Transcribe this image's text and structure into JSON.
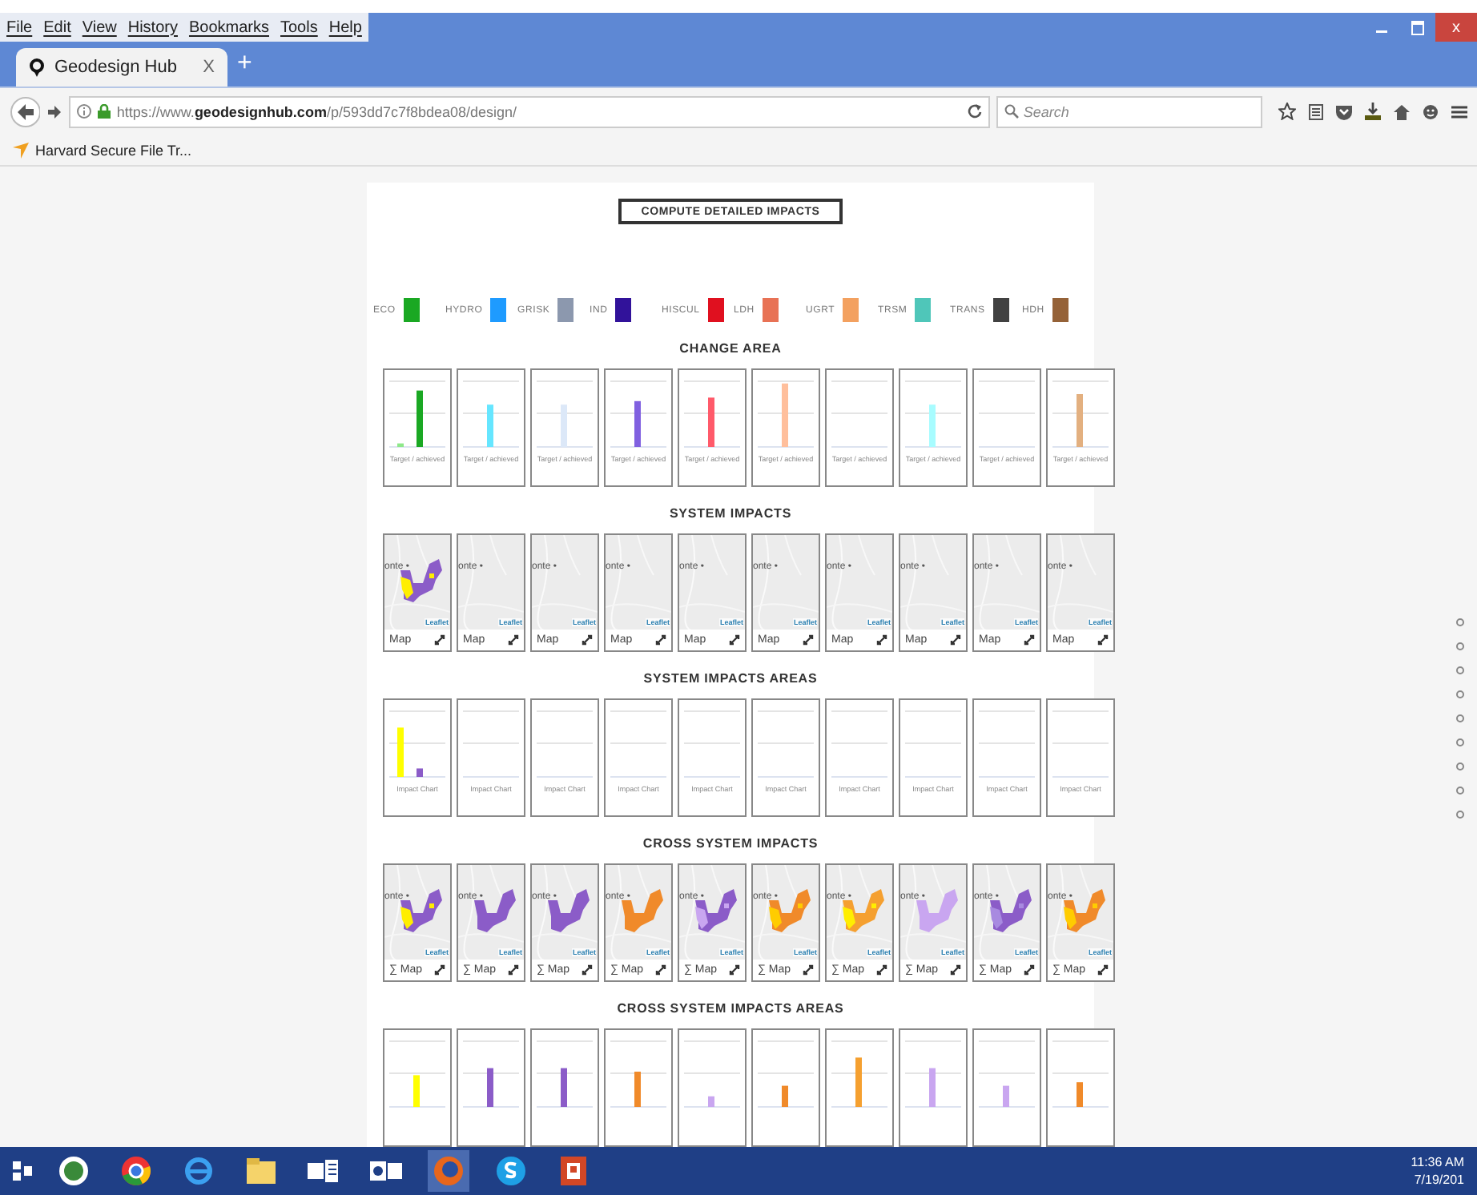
{
  "menu": [
    "File",
    "Edit",
    "View",
    "History",
    "Bookmarks",
    "Tools",
    "Help"
  ],
  "window_controls": {
    "close": "x"
  },
  "tab": {
    "title": "Geodesign Hub",
    "close": "X",
    "new_tab": "+",
    "selected": true
  },
  "address": {
    "prefix": "https://www.",
    "host": "geodesignhub.com",
    "path": "/p/593dd7c7f8bdea08/design/"
  },
  "search": {
    "placeholder": "Search"
  },
  "bookmarks": [
    "Harvard Secure File Tr..."
  ],
  "page": {
    "button": "COMPUTE DETAILED IMPACTS",
    "legend": [
      {
        "label": "ECO",
        "color": "#1aa823"
      },
      {
        "label": "HYDRO",
        "color": "#1e9bff"
      },
      {
        "label": "GRISK",
        "color": "#8c98ae"
      },
      {
        "label": "IND",
        "color": "#31129a"
      },
      {
        "label": "HISCUL",
        "color": "#e0101f"
      },
      {
        "label": "LDH",
        "color": "#e87255"
      },
      {
        "label": "UGRT",
        "color": "#f3a160"
      },
      {
        "label": "TRSM",
        "color": "#4fc6b9"
      },
      {
        "label": "TRANS",
        "color": "#414141"
      },
      {
        "label": "HDH",
        "color": "#956238"
      }
    ],
    "sections": [
      {
        "title": "CHANGE AREA",
        "cells": [
          {
            "kind": "bars",
            "caption": "Target / achieved"
          },
          {
            "kind": "bars",
            "caption": "Target / achieved"
          },
          {
            "kind": "bars",
            "caption": "Target / achieved"
          },
          {
            "kind": "bars",
            "caption": "Target / achieved"
          },
          {
            "kind": "bars",
            "caption": "Target / achieved"
          },
          {
            "kind": "bars",
            "caption": "Target / achieved"
          },
          {
            "kind": "bars",
            "caption": "Target / achieved"
          },
          {
            "kind": "bars",
            "caption": "Target / achieved"
          },
          {
            "kind": "bars",
            "caption": "Target / achieved"
          },
          {
            "kind": "bars",
            "caption": "Target / achieved"
          }
        ]
      },
      {
        "title": "SYSTEM IMPACTS",
        "cells": [
          {
            "kind": "map",
            "place": "onte •",
            "attribution": "Leaflet",
            "label": "Map"
          },
          {
            "kind": "map",
            "place": "onte •",
            "attribution": "Leaflet",
            "label": "Map"
          },
          {
            "kind": "map",
            "place": "onte •",
            "attribution": "Leaflet",
            "label": "Map"
          },
          {
            "kind": "map",
            "place": "onte •",
            "attribution": "Leaflet",
            "label": "Map"
          },
          {
            "kind": "map",
            "place": "onte •",
            "attribution": "Leaflet",
            "label": "Map"
          },
          {
            "kind": "map",
            "place": "onte •",
            "attribution": "Leaflet",
            "label": "Map"
          },
          {
            "kind": "map",
            "place": "onte •",
            "attribution": "Leaflet",
            "label": "Map"
          },
          {
            "kind": "map",
            "place": "onte •",
            "attribution": "Leaflet",
            "label": "Map"
          },
          {
            "kind": "map",
            "place": "onte •",
            "attribution": "Leaflet",
            "label": "Map"
          },
          {
            "kind": "map",
            "place": "onte •",
            "attribution": "Leaflet",
            "label": "Map"
          }
        ]
      },
      {
        "title": "SYSTEM IMPACTS AREAS",
        "cells": [
          {
            "kind": "bars",
            "caption": "Impact Chart"
          },
          {
            "kind": "bars",
            "caption": "Impact Chart"
          },
          {
            "kind": "bars",
            "caption": "Impact Chart"
          },
          {
            "kind": "bars",
            "caption": "Impact Chart"
          },
          {
            "kind": "bars",
            "caption": "Impact Chart"
          },
          {
            "kind": "bars",
            "caption": "Impact Chart"
          },
          {
            "kind": "bars",
            "caption": "Impact Chart"
          },
          {
            "kind": "bars",
            "caption": "Impact Chart"
          },
          {
            "kind": "bars",
            "caption": "Impact Chart"
          },
          {
            "kind": "bars",
            "caption": "Impact Chart"
          }
        ]
      },
      {
        "title": "CROSS SYSTEM IMPACTS",
        "cells": [
          {
            "kind": "map",
            "place": "onte •",
            "attribution": "Leaflet",
            "label": "∑ Map"
          },
          {
            "kind": "map",
            "place": "onte •",
            "attribution": "Leaflet",
            "label": "∑ Map"
          },
          {
            "kind": "map",
            "place": "onte •",
            "attribution": "Leaflet",
            "label": "∑ Map"
          },
          {
            "kind": "map",
            "place": "onte •",
            "attribution": "Leaflet",
            "label": "∑ Map"
          },
          {
            "kind": "map",
            "place": "onte •",
            "attribution": "Leaflet",
            "label": "∑ Map"
          },
          {
            "kind": "map",
            "place": "onte •",
            "attribution": "Leaflet",
            "label": "∑ Map"
          },
          {
            "kind": "map",
            "place": "onte •",
            "attribution": "Leaflet",
            "label": "∑ Map"
          },
          {
            "kind": "map",
            "place": "onte •",
            "attribution": "Leaflet",
            "label": "∑ Map"
          },
          {
            "kind": "map",
            "place": "onte •",
            "attribution": "Leaflet",
            "label": "∑ Map"
          },
          {
            "kind": "map",
            "place": "onte •",
            "attribution": "Leaflet",
            "label": "∑ Map"
          }
        ]
      },
      {
        "title": "CROSS SYSTEM IMPACTS AREAS",
        "cells": [
          {
            "kind": "bars"
          },
          {
            "kind": "bars"
          },
          {
            "kind": "bars"
          },
          {
            "kind": "bars"
          },
          {
            "kind": "bars"
          },
          {
            "kind": "bars"
          },
          {
            "kind": "bars"
          },
          {
            "kind": "bars"
          },
          {
            "kind": "bars"
          },
          {
            "kind": "bars"
          }
        ]
      }
    ]
  },
  "taskbar": {
    "time": "11:36 AM",
    "date": "7/19/201"
  }
}
